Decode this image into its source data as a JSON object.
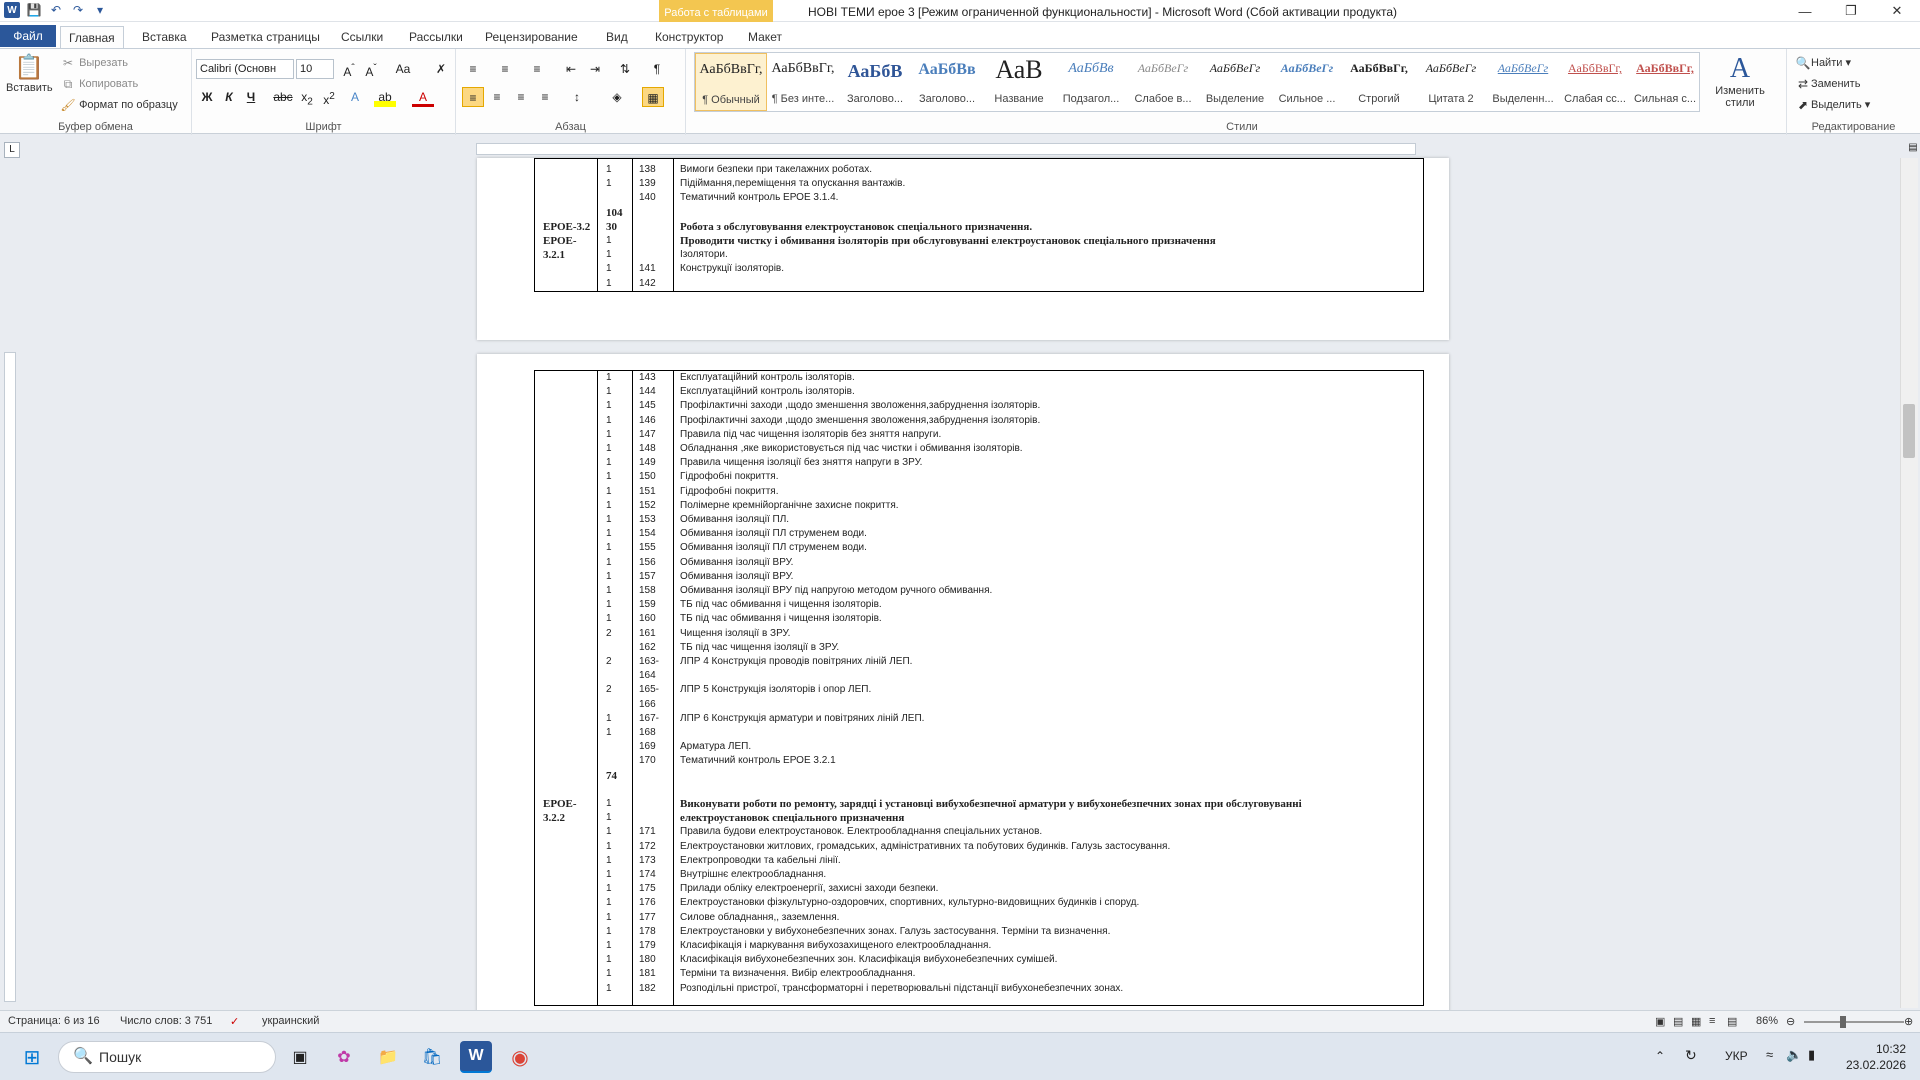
{
  "titlebar": {
    "context_tab_group": "Работа с таблицами",
    "document_title": "НОВІ ТЕМИ ерое 3 [Режим ограниченной функциональности]  -  Microsoft Word (Сбой активации продукта)"
  },
  "tabs": [
    "Файл",
    "Главная",
    "Вставка",
    "Разметка страницы",
    "Ссылки",
    "Рассылки",
    "Рецензирование",
    "Вид",
    "Конструктор",
    "Макет"
  ],
  "ribbon": {
    "clipboard": {
      "paste": "Вставить",
      "cut": "Вырезать",
      "copy": "Копировать",
      "format_painter": "Формат по образцу",
      "label": "Буфер обмена"
    },
    "font": {
      "name": "Calibri (Основн",
      "size": "10",
      "label": "Шрифт"
    },
    "paragraph": {
      "label": "Абзац"
    },
    "styles": {
      "label": "Стили",
      "change_styles": "Изменить стили",
      "items": [
        {
          "preview": "АаБбВвГг,",
          "name": "¶ Обычный"
        },
        {
          "preview": "АаБбВвГг,",
          "name": "¶ Без инте..."
        },
        {
          "preview": "АаБбВ",
          "name": "Заголово..."
        },
        {
          "preview": "АаБбВв",
          "name": "Заголово..."
        },
        {
          "preview": "АаВ",
          "name": "Название"
        },
        {
          "preview": "АаБбВв",
          "name": "Подзагол..."
        },
        {
          "preview": "АаБбВеГг",
          "name": "Слабое в..."
        },
        {
          "preview": "АаБбВеГг",
          "name": "Выделение"
        },
        {
          "preview": "АаБбВеГг",
          "name": "Сильное ..."
        },
        {
          "preview": "АаБбВвГг,",
          "name": "Строгий"
        },
        {
          "preview": "АаБбВеГг",
          "name": "Цитата 2"
        },
        {
          "preview": "АаБбВеГг",
          "name": "Выделенн..."
        },
        {
          "preview": "АаБбВвГг,",
          "name": "Слабая сс..."
        },
        {
          "preview": "АаБбВвГг,",
          "name": "Сильная с..."
        }
      ]
    },
    "editing": {
      "find": "Найти",
      "replace": "Заменить",
      "select": "Выделить",
      "label": "Редактирование"
    }
  },
  "page1": {
    "rows": [
      {
        "c1": "",
        "c2": "1",
        "c3": "138",
        "c4": "Вимоги безпеки при такелажних роботах."
      },
      {
        "c1": "",
        "c2": "1",
        "c3": "139",
        "c4": "Підіймання,переміщення та опускання вантажів."
      },
      {
        "c1": "",
        "c2": "",
        "c3": "140",
        "c4": "Тематичний контроль ЕРОЕ 3.1.4."
      },
      {
        "c1": "",
        "c2": "104",
        "c3": "",
        "c4": ""
      },
      {
        "c1": "ЕРОЕ-3.2",
        "c2": "30",
        "c3": "",
        "c4": "Робота з обслуговування електроустановок спеціального призначення."
      },
      {
        "c1": "ЕРОЕ-",
        "c2": "1",
        "c3": "",
        "c4": "Проводити чистку і обмивання ізоляторів при обслуговуванні електроустановок спеціального призначення"
      },
      {
        "c1": "3.2.1",
        "c2": "1",
        "c3": "",
        "c4": "Ізолятори."
      },
      {
        "c1": "",
        "c2": "1",
        "c3": "141",
        "c4": "Конструкції ізоляторів."
      },
      {
        "c1": "",
        "c2": "1",
        "c3": "142",
        "c4": ""
      }
    ]
  },
  "page2": {
    "rows": [
      {
        "c1": "",
        "c2": "1",
        "c3": "143",
        "c4": "Експлуатаційний контроль ізоляторів."
      },
      {
        "c1": "",
        "c2": "1",
        "c3": "144",
        "c4": "Експлуатаційний контроль ізоляторів."
      },
      {
        "c1": "",
        "c2": "1",
        "c3": "145",
        "c4": "Профілактичні заходи ,щодо зменшення зволоження,забруднення ізоляторів."
      },
      {
        "c1": "",
        "c2": "1",
        "c3": "146",
        "c4": "Профілактичні заходи ,щодо зменшення зволоження,забруднення ізоляторів."
      },
      {
        "c1": "",
        "c2": "1",
        "c3": "147",
        "c4": "Правила під час чищення ізоляторів без зняття напруги."
      },
      {
        "c1": "",
        "c2": "1",
        "c3": "148",
        "c4": "Обладнання ,яке використовується під час чистки і обмивання ізоляторів."
      },
      {
        "c1": "",
        "c2": "1",
        "c3": "149",
        "c4": "Правила чищення ізоляції без зняття напруги в ЗРУ."
      },
      {
        "c1": "",
        "c2": "1",
        "c3": "150",
        "c4": "Гідрофобні покриття."
      },
      {
        "c1": "",
        "c2": "1",
        "c3": "151",
        "c4": "Гідрофобні покриття."
      },
      {
        "c1": "",
        "c2": "1",
        "c3": "152",
        "c4": "Полімерне кремнійорганічне захисне покриття."
      },
      {
        "c1": "",
        "c2": "1",
        "c3": "153",
        "c4": "Обмивання ізоляції  ПЛ."
      },
      {
        "c1": "",
        "c2": "1",
        "c3": "154",
        "c4": "Обмивання ізоляції  ПЛ струменем води."
      },
      {
        "c1": "",
        "c2": "1",
        "c3": "155",
        "c4": "Обмивання ізоляції  ПЛ струменем води."
      },
      {
        "c1": "",
        "c2": "1",
        "c3": "156",
        "c4": "Обмивання ізоляції  ВРУ."
      },
      {
        "c1": "",
        "c2": "1",
        "c3": "157",
        "c4": "Обмивання ізоляції  ВРУ."
      },
      {
        "c1": "",
        "c2": "1",
        "c3": "158",
        "c4": "Обмивання ізоляції  ВРУ під напругою методом ручного обмивання."
      },
      {
        "c1": "",
        "c2": "1",
        "c3": "159",
        "c4": "ТБ під час обмивання і чищення ізоляторів."
      },
      {
        "c1": "",
        "c2": "1",
        "c3": "160",
        "c4": "ТБ під час обмивання і чищення ізоляторів."
      },
      {
        "c1": "",
        "c2": "2",
        "c3": "161",
        "c4": "Чищення ізоляції в ЗРУ."
      },
      {
        "c1": "",
        "c2": "",
        "c3": "162",
        "c4": "ТБ під час чищення ізоляції в ЗРУ."
      },
      {
        "c1": "",
        "c2": "2",
        "c3": "163-",
        "c4": "ЛПР 4 Конструкція проводів повітряних ліній ЛЕП."
      },
      {
        "c1": "",
        "c2": "",
        "c3": "164",
        "c4": ""
      },
      {
        "c1": "",
        "c2": "2",
        "c3": "165-",
        "c4": "ЛПР 5 Конструкція ізоляторів і опор ЛЕП."
      },
      {
        "c1": "",
        "c2": "",
        "c3": "166",
        "c4": ""
      },
      {
        "c1": "",
        "c2": "1",
        "c3": "167-",
        "c4": "ЛПР 6 Конструкція арматури и повітряних ліній ЛЕП."
      },
      {
        "c1": "",
        "c2": "1",
        "c3": "168",
        "c4": ""
      },
      {
        "c1": "",
        "c2": "",
        "c3": "169",
        "c4": "Арматура ЛЕП."
      },
      {
        "c1": "",
        "c2": "",
        "c3": "170",
        "c4": "Тематичний контроль ЕРОЕ 3.2.1"
      },
      {
        "c1": "",
        "c2": "74",
        "c3": "",
        "c4": ""
      },
      {
        "c1": "",
        "c2": "",
        "c3": "",
        "c4": ""
      },
      {
        "c1": "ЕРОЕ-",
        "c2": "1",
        "c3": "",
        "c4": "Виконувати роботи по ремонту, зарядці і установці вибухобезпечної арматури у вибухонебезпечних зонах при обслуговуванні"
      },
      {
        "c1": "3.2.2",
        "c2": "1",
        "c3": "",
        "c4": "електроустановок спеціального призначення"
      },
      {
        "c1": "",
        "c2": "1",
        "c3": "171",
        "c4": "Правила будови електроустановок. Електрообладнання спеціальних установ."
      },
      {
        "c1": "",
        "c2": "1",
        "c3": "172",
        "c4": "Електроустановки житлових, громадських, адміністративних та побутових будинків. Галузь застосування."
      },
      {
        "c1": "",
        "c2": "1",
        "c3": "173",
        "c4": "Електропроводки та кабельні лінії."
      },
      {
        "c1": "",
        "c2": "1",
        "c3": "174",
        "c4": "Внутрішнє електрообладнання."
      },
      {
        "c1": "",
        "c2": "1",
        "c3": "175",
        "c4": "Прилади обліку електроенергії, захисні заходи безпеки."
      },
      {
        "c1": "",
        "c2": "1",
        "c3": "176",
        "c4": "Електроустановки фізкультурно-оздоровчих, спортивних, культурно-видовищних будинків і споруд."
      },
      {
        "c1": "",
        "c2": "1",
        "c3": "177",
        "c4": "Силове обладнання,, заземлення."
      },
      {
        "c1": "",
        "c2": "1",
        "c3": "178",
        "c4": "Електроустановки у вибухонебезпечних зонах. Галузь застосування. Терміни та визначення."
      },
      {
        "c1": "",
        "c2": "1",
        "c3": "179",
        "c4": "Класифікація і маркування вибухозахищеного електрообладнання."
      },
      {
        "c1": "",
        "c2": "1",
        "c3": "180",
        "c4": "Класифікація вибухонебезпечних зон. Класифікація вибухонебезпечних сумішей."
      },
      {
        "c1": "",
        "c2": "1",
        "c3": "181",
        "c4": "Терміни та визначення. Вибір електрообладнання."
      },
      {
        "c1": "",
        "c2": "1",
        "c3": "182",
        "c4": "Розподільні пристрої, трансформаторні і перетворювальні підстанції вибухонебезпечних зонах."
      }
    ]
  },
  "statusbar": {
    "page": "Страница: 6 из 16",
    "words": "Число слов: 3 751",
    "language": "украинский",
    "zoom": "86%"
  },
  "taskbar": {
    "search": "Пошук",
    "lang": "УКР",
    "time": "10:32",
    "date": "23.02.2026"
  }
}
